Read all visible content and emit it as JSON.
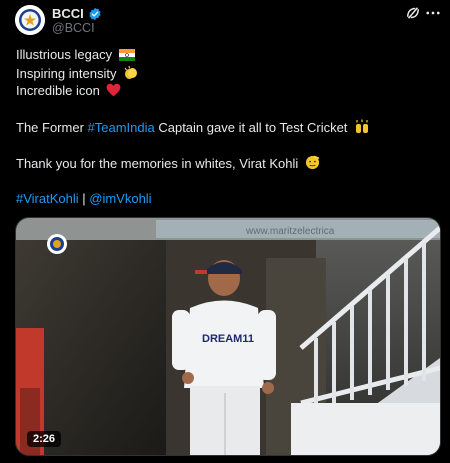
{
  "author": {
    "name": "BCCI",
    "handle": "@BCCI"
  },
  "post": {
    "line1": "Illustrious legacy",
    "line2": "Inspiring intensity",
    "line3": "Incredible icon",
    "line4_pre": "The Former ",
    "line4_tag": "#TeamIndia",
    "line4_post": " Captain gave it all to Test Cricket",
    "line5": "Thank you for the memories in whites, Virat Kohli",
    "tag_kohli": "#ViratKohli",
    "separator": " | ",
    "mention": "@imVkohli"
  },
  "media": {
    "duration": "2:26",
    "banner_text": "www.maritzelectrica",
    "jersey_text": "DREAM11"
  },
  "icons": {
    "verified": "verified-badge-icon",
    "grok": "grok-icon",
    "more": "more-options-icon"
  },
  "colors": {
    "link": "#1d9bf0",
    "verified": "#1d9bf0"
  }
}
